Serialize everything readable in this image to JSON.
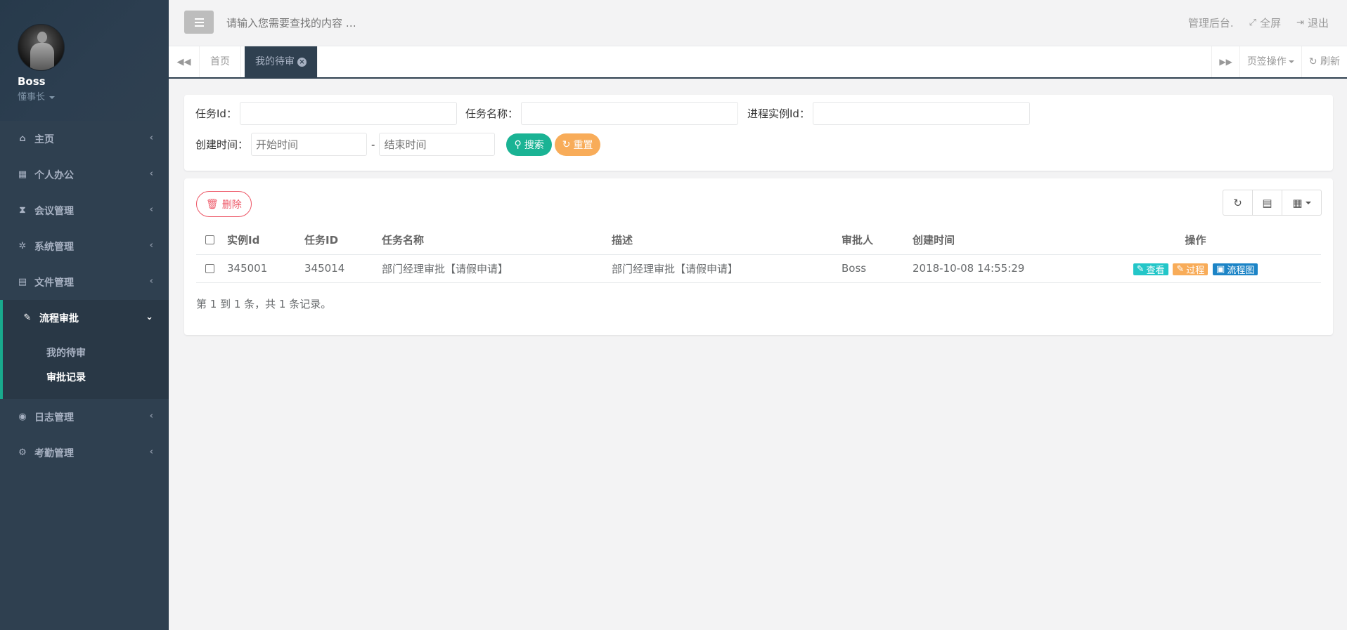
{
  "user": {
    "name": "Boss",
    "role": "懂事长"
  },
  "sidebar": {
    "items": [
      {
        "label": "主页",
        "icon": "home-icon"
      },
      {
        "label": "个人办公",
        "icon": "calendar-icon"
      },
      {
        "label": "会议管理",
        "icon": "hourglass-icon"
      },
      {
        "label": "系统管理",
        "icon": "gear-icon"
      },
      {
        "label": "文件管理",
        "icon": "file-icon"
      },
      {
        "label": "流程审批",
        "icon": "gavel-icon"
      },
      {
        "label": "日志管理",
        "icon": "eye-icon"
      },
      {
        "label": "考勤管理",
        "icon": "gears-icon"
      }
    ],
    "submenu": [
      "我的待审",
      "审批记录"
    ]
  },
  "topbar": {
    "search_placeholder": "请输入您需要查找的内容 …",
    "admin_label": "管理后台.",
    "fullscreen_label": "全屏",
    "logout_label": "退出"
  },
  "tabs": {
    "home": "首页",
    "current": "我的待审",
    "tab_ops": "页签操作",
    "refresh": "刷新"
  },
  "search": {
    "task_id_label": "任务Id：",
    "task_name_label": "任务名称：",
    "process_id_label": "进程实例Id：",
    "create_time_label": "创建时间：",
    "start_placeholder": "开始时间",
    "end_placeholder": "结束时间",
    "dash": "-",
    "search_btn": "搜索",
    "reset_btn": "重置"
  },
  "table": {
    "delete_btn": "删除",
    "headers": [
      "实例Id",
      "任务ID",
      "任务名称",
      "描述",
      "审批人",
      "创建时间",
      "操作"
    ],
    "rows": [
      {
        "instance_id": "345001",
        "task_id": "345014",
        "task_name": "部门经理审批【请假申请】",
        "description": "部门经理审批【请假申请】",
        "approver": "Boss",
        "create_time": "2018-10-08 14:55:29",
        "actions": [
          "查看",
          "过程",
          "流程图"
        ]
      }
    ],
    "pager_text": "第 1 到 1 条，共 1 条记录。"
  },
  "colors": {
    "sidebar": "#2f4050",
    "accent": "#19aa8d",
    "danger": "#ed5565",
    "warning": "#f8ac59",
    "info": "#23c6c8",
    "primary": "#1c84c6"
  }
}
